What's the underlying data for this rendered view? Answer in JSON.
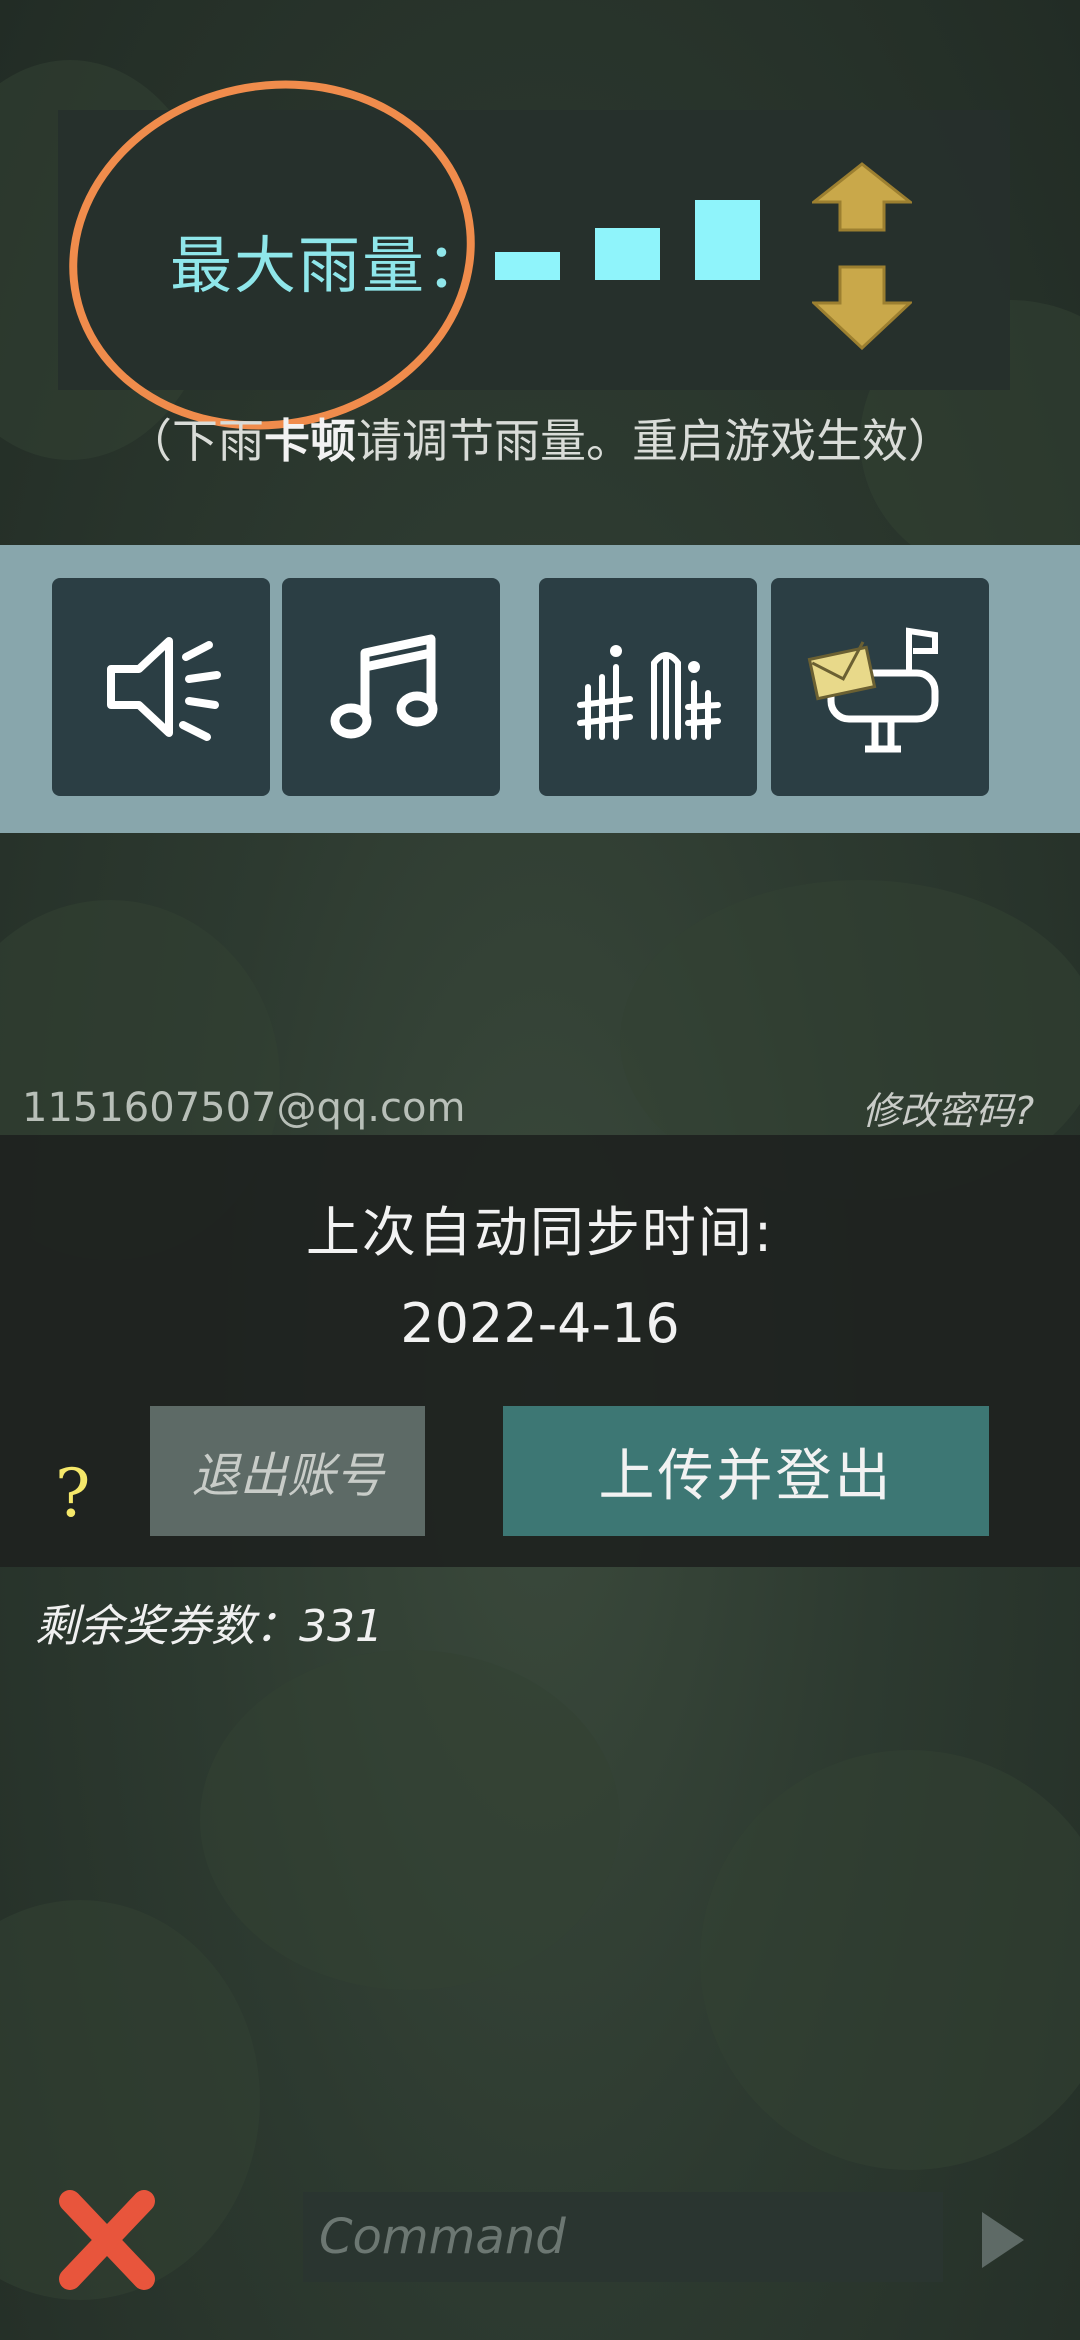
{
  "rain": {
    "label": "最大雨量：",
    "hint_prefix": "（下雨",
    "hint_bold": "卡顿",
    "hint_suffix": "请调节雨量。重启游戏生效）",
    "level_bars": 3
  },
  "toolbar": {
    "items": [
      "sound",
      "music",
      "fence",
      "mailbox"
    ]
  },
  "account": {
    "email": "1151607507@qq.com",
    "change_password": "修改密码?",
    "sync_title": "上次自动同步时间:",
    "sync_date": "2022-4-16",
    "logout_label": "退出账号",
    "upload_label": "上传并登出",
    "help": "?",
    "tickets": "剩余奖券数：331"
  },
  "command": {
    "placeholder": "Command"
  },
  "colors": {
    "accent_cyan": "#8ff4fb",
    "arrow_gold": "#c9a84a",
    "close_red": "#e8553c",
    "annotation_orange": "#f08c4c",
    "upload_teal": "#3d7774"
  }
}
